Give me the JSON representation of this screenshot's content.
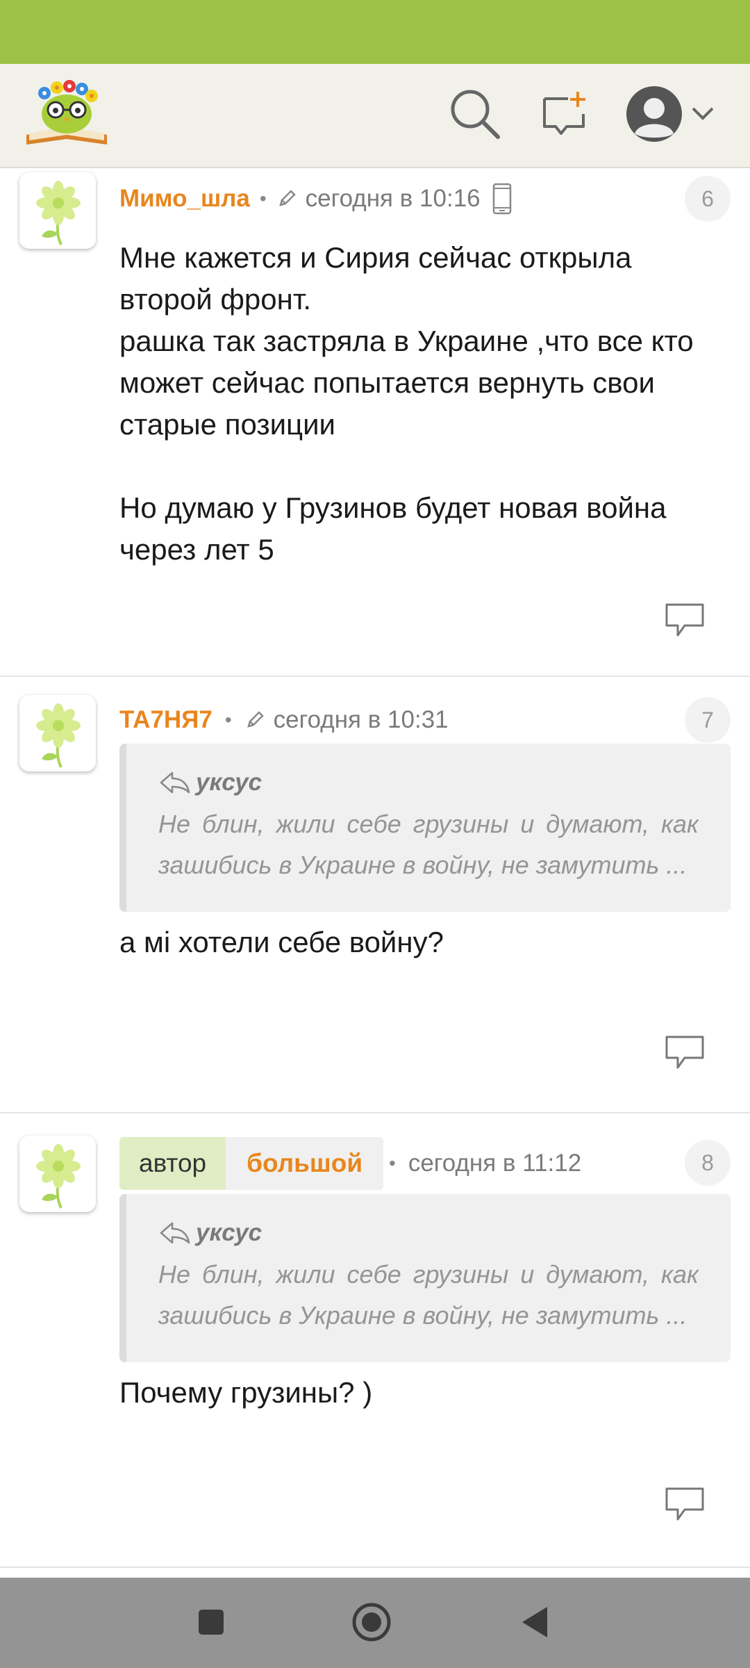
{
  "header": {
    "logo_icon": "owl-on-book-logo",
    "icons": [
      "search-icon",
      "add-comment-icon",
      "user-avatar-icon",
      "chevron-down-icon"
    ]
  },
  "comments": [
    {
      "author": "Мимо_шла",
      "time": "сегодня в 10:16",
      "number": "6",
      "text": "Мне кажется и Сирия сейчас открыла второй фронт.\nрашка так застряла в Украине ,что все кто может сейчас попытается вернуть свои старые позиции\n\nНо думаю у Грузинов будет новая война через лет 5"
    },
    {
      "author": "ТА7НЯ7",
      "time": "сегодня в 10:31",
      "number": "7",
      "quote_author": "уксус",
      "quote_line1": "Не блин, жили себе грузины и думают, как",
      "quote_line2": "зашибись в Украине в войну, не замутить ...",
      "text": "а мі хотели себе войну?"
    },
    {
      "tag_author": "автор",
      "tag_big": "большой",
      "time": "сегодня в 11:12",
      "number": "8",
      "quote_author": "уксус",
      "quote_line1": "Не блин, жили себе грузины и думают, как",
      "quote_line2": "зашибись в Украине в войну, не замутить ...",
      "text": "Почему грузины? )"
    }
  ],
  "colors": {
    "status_bar": "#9dc147",
    "header_bg": "#f1f1ea",
    "author": "#e8861e",
    "tag_author_bg": "#e0edc4",
    "nav_bar": "#949494"
  }
}
